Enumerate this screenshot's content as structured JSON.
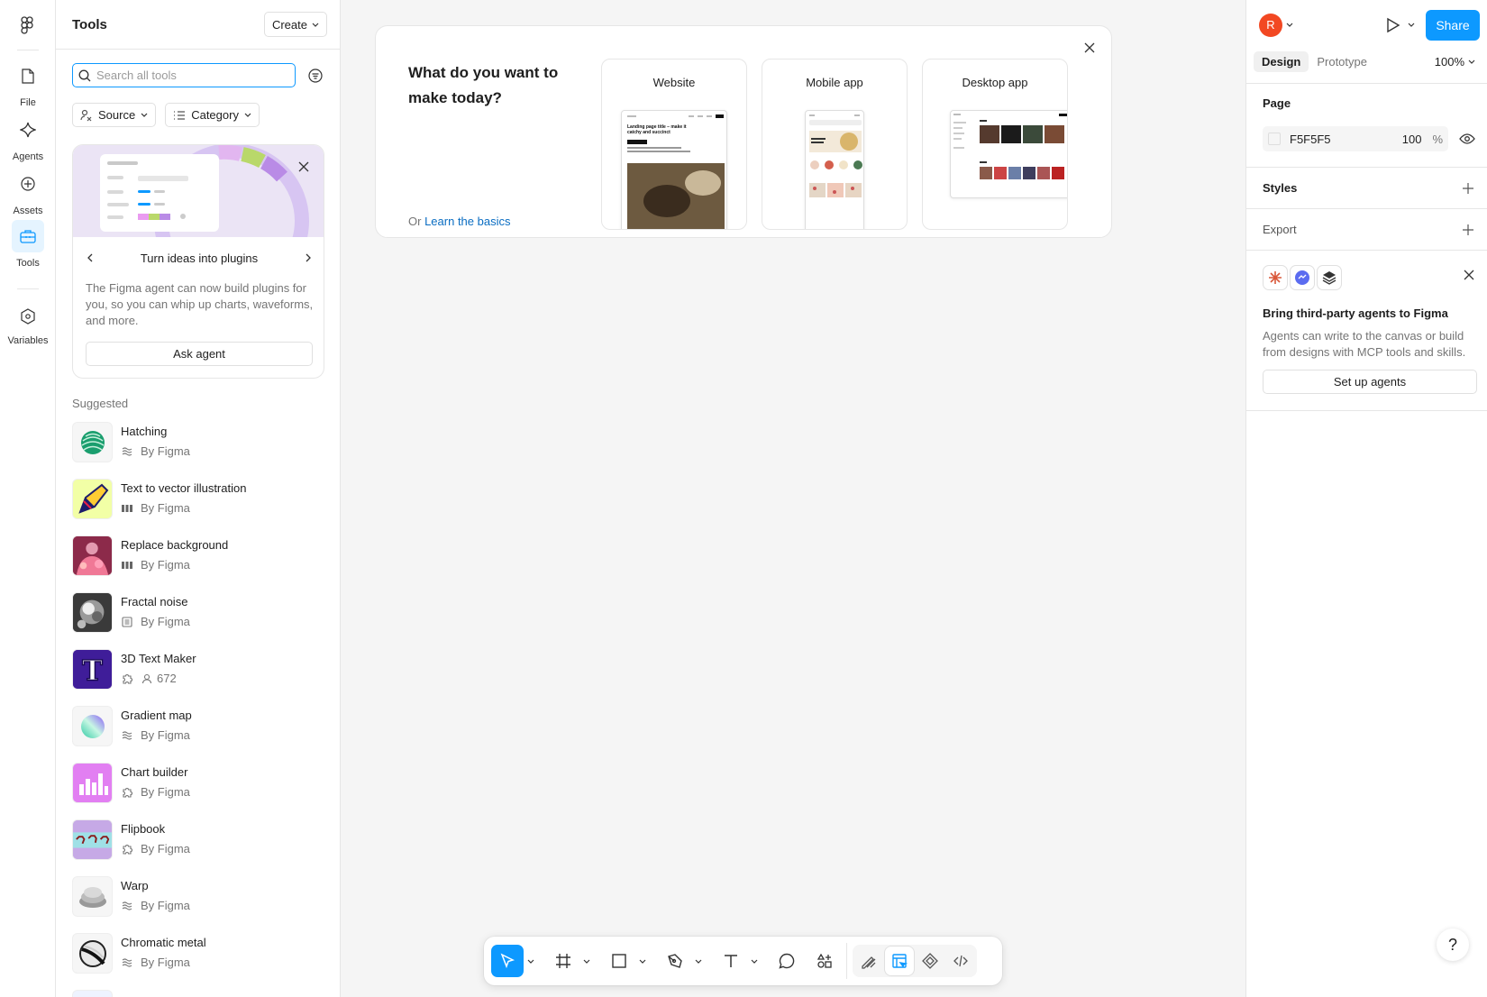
{
  "rail": {
    "items": [
      {
        "label": "File",
        "icon": "file-icon"
      },
      {
        "label": "Agents",
        "icon": "sparkle-icon"
      },
      {
        "label": "Assets",
        "icon": "assets-icon"
      },
      {
        "label": "Tools",
        "icon": "toolbox-icon",
        "active": true
      },
      {
        "label": "Variables",
        "icon": "variables-icon"
      }
    ]
  },
  "tools_panel": {
    "title": "Tools",
    "create_label": "Create",
    "search_placeholder": "Search all tools",
    "filters": {
      "source": "Source",
      "category": "Category"
    },
    "promo": {
      "title": "Turn ideas into plugins",
      "description": "The Figma agent can now build plugins for you, so you can whip up charts, waveforms, and more.",
      "button": "Ask agent"
    },
    "suggested_label": "Suggested",
    "tools": [
      {
        "name": "Hatching",
        "meta": "By Figma",
        "meta_icon": "waves-icon"
      },
      {
        "name": "Text to vector illustration",
        "meta": "By Figma",
        "meta_icon": "weave-icon"
      },
      {
        "name": "Replace background",
        "meta": "By Figma",
        "meta_icon": "weave-icon"
      },
      {
        "name": "Fractal noise",
        "meta": "By Figma",
        "meta_icon": "list-icon"
      },
      {
        "name": "3D Text Maker",
        "meta": "672",
        "meta_icon": "user-icon"
      },
      {
        "name": "Gradient map",
        "meta": "By Figma",
        "meta_icon": "waves-icon"
      },
      {
        "name": "Chart builder",
        "meta": "By Figma",
        "meta_icon": "puzzle-icon"
      },
      {
        "name": "Flipbook",
        "meta": "By Figma",
        "meta_icon": "puzzle-icon"
      },
      {
        "name": "Warp",
        "meta": "By Figma",
        "meta_icon": "waves-icon"
      },
      {
        "name": "Chromatic metal",
        "meta": "By Figma",
        "meta_icon": "waves-icon"
      }
    ]
  },
  "start_card": {
    "title": "What do you want to make today?",
    "learn_prefix": "Or",
    "learn_link": "Learn the basics",
    "types": [
      {
        "label": "Website"
      },
      {
        "label": "Mobile app"
      },
      {
        "label": "Desktop app"
      }
    ],
    "website_preview_headline": "Landing page title – make it catchy and succinct"
  },
  "right_panel": {
    "avatar_initial": "R",
    "share_label": "Share",
    "tabs": [
      {
        "label": "Design",
        "active": true
      },
      {
        "label": "Prototype",
        "active": false
      }
    ],
    "zoom": "100%",
    "page": {
      "title": "Page",
      "color": "F5F5F5",
      "opacity": "100",
      "opacity_unit": "%"
    },
    "styles_title": "Styles",
    "export_title": "Export",
    "agents": {
      "title": "Bring third-party agents to Figma",
      "description": "Agents can write to the canvas or build from designs with MCP tools and skills.",
      "button": "Set up agents"
    },
    "help": "?"
  },
  "colors": {
    "accent": "#0d99ff",
    "link": "#0a6dc2",
    "avatar": "#f24822"
  }
}
